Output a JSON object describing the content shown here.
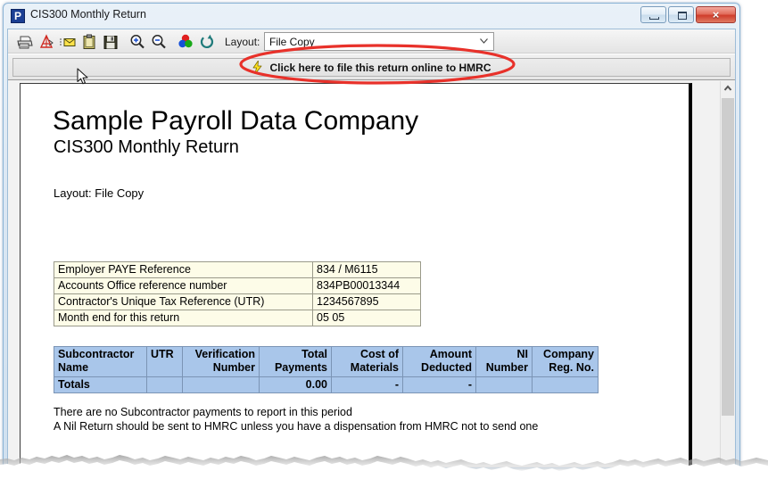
{
  "window": {
    "title": "CIS300 Monthly Return",
    "app_icon": "P",
    "controls": {
      "minimize": "minimize-button",
      "maximize": "maximize-button",
      "close": "×"
    }
  },
  "toolbar": {
    "icons": [
      "print-icon",
      "export-pdf-icon",
      "email-icon",
      "clipboard-icon",
      "save-icon",
      "zoom-in-icon",
      "zoom-out-icon",
      "color-palette-icon",
      "refresh-icon"
    ],
    "layout_label": "Layout:",
    "layout_value": "File Copy"
  },
  "action_bar": {
    "button_label": "Click here to file this return online to HMRC",
    "button_icon": "lightning-bolt-icon"
  },
  "document": {
    "company_name": "Sample Payroll Data Company",
    "report_title": "CIS300 Monthly Return",
    "layout_line": "Layout: File Copy",
    "reference_table": {
      "rows": [
        {
          "label": "Employer PAYE Reference",
          "value": "834 / M6115"
        },
        {
          "label": "Accounts Office reference number",
          "value": "834PB00013344"
        },
        {
          "label": "Contractor's Unique Tax Reference (UTR)",
          "value": "1234567895"
        },
        {
          "label": "Month end for this return",
          "value": "05 05"
        }
      ]
    },
    "subcontractor_table": {
      "headers": [
        "Subcontractor Name",
        "UTR",
        "Verification Number",
        "Total Payments",
        "Cost of Materials",
        "Amount Deducted",
        "NI Number",
        "Company Reg. No."
      ],
      "totals_row": [
        "Totals",
        "",
        "",
        "0.00",
        "-",
        "-",
        "",
        ""
      ]
    },
    "notes": [
      "There are no Subcontractor payments to report in this period",
      "A Nil Return should be sent to HMRC unless you have a dispensation from HMRC not to send one"
    ]
  },
  "scrollbar": {
    "up_arrow": "scroll-up-arrow"
  },
  "annotation": {
    "type": "red-ellipse-highlight",
    "color": "#e8312a"
  },
  "colors": {
    "header_blue": "#a9c6ea",
    "reference_yellow": "#fdfce8",
    "annotation_red": "#e8312a",
    "title_bar": "#dbe7f3"
  }
}
